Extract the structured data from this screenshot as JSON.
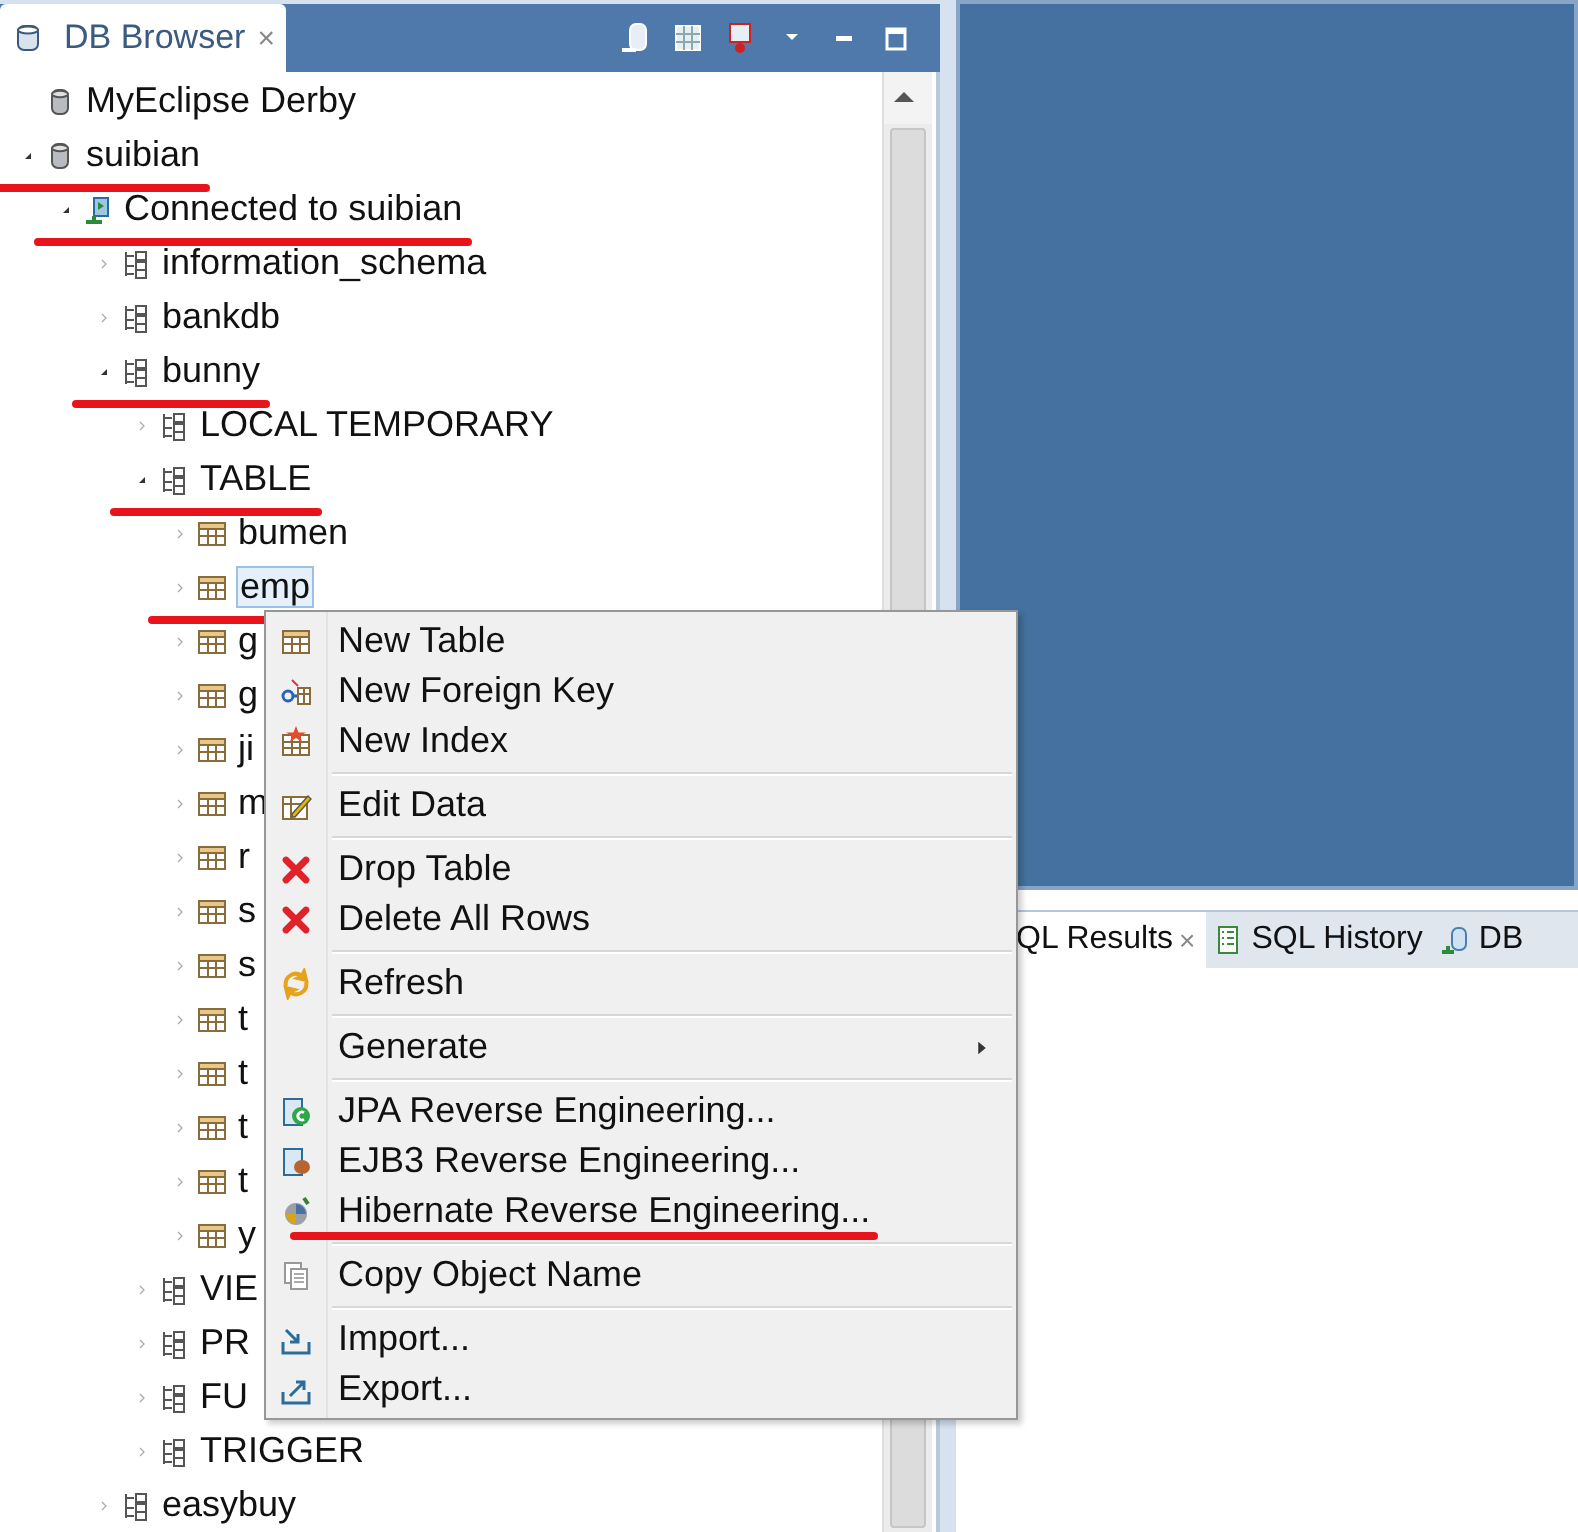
{
  "db_browser": {
    "tab": {
      "label": "DB Browser",
      "close": "×",
      "selected": true
    },
    "tree": [
      {
        "label": "MyEclipse Derby",
        "kind": "database",
        "selected": false,
        "marked": false
      },
      {
        "label": "suibian",
        "kind": "database",
        "expanded": true,
        "selected": false,
        "marked": true,
        "children": [
          {
            "label": "Connected to suibian",
            "kind": "connection",
            "expanded": true,
            "selected": false,
            "marked": true,
            "children": [
              {
                "label": "information_schema",
                "kind": "schema",
                "expanded": false,
                "selected": false,
                "marked": false
              },
              {
                "label": "bankdb",
                "kind": "schema",
                "expanded": false,
                "selected": false,
                "marked": false
              },
              {
                "label": "bunny",
                "kind": "schema",
                "expanded": true,
                "selected": false,
                "marked": true,
                "children": [
                  {
                    "label": "LOCAL TEMPORARY",
                    "kind": "schema",
                    "expanded": false,
                    "selected": false,
                    "marked": false
                  },
                  {
                    "label": "TABLE",
                    "kind": "schema",
                    "expanded": true,
                    "selected": false,
                    "marked": true,
                    "children": [
                      {
                        "label": "bumen",
                        "kind": "table",
                        "expanded": false,
                        "selected": false,
                        "marked": false
                      },
                      {
                        "label": "emp",
                        "kind": "table",
                        "expanded": false,
                        "selected": true,
                        "marked": true
                      },
                      {
                        "label": "g",
                        "kind": "table",
                        "expanded": false,
                        "selected": false,
                        "marked": false
                      },
                      {
                        "label": "g",
                        "kind": "table",
                        "expanded": false,
                        "selected": false,
                        "marked": false
                      },
                      {
                        "label": "ji",
                        "kind": "table",
                        "expanded": false,
                        "selected": false,
                        "marked": false
                      },
                      {
                        "label": "m",
                        "kind": "table",
                        "expanded": false,
                        "selected": false,
                        "marked": false
                      },
                      {
                        "label": "r",
                        "kind": "table",
                        "expanded": false,
                        "selected": false,
                        "marked": false
                      },
                      {
                        "label": "s",
                        "kind": "table",
                        "expanded": false,
                        "selected": false,
                        "marked": false
                      },
                      {
                        "label": "s",
                        "kind": "table",
                        "expanded": false,
                        "selected": false,
                        "marked": false
                      },
                      {
                        "label": "t",
                        "kind": "table",
                        "expanded": false,
                        "selected": false,
                        "marked": false
                      },
                      {
                        "label": "t",
                        "kind": "table",
                        "expanded": false,
                        "selected": false,
                        "marked": false
                      },
                      {
                        "label": "t",
                        "kind": "table",
                        "expanded": false,
                        "selected": false,
                        "marked": false
                      },
                      {
                        "label": "t",
                        "kind": "table",
                        "expanded": false,
                        "selected": false,
                        "marked": false
                      },
                      {
                        "label": "y",
                        "kind": "table",
                        "expanded": false,
                        "selected": false,
                        "marked": false
                      }
                    ]
                  },
                  {
                    "label": "VIE",
                    "kind": "schema",
                    "expanded": false,
                    "selected": false,
                    "marked": false
                  },
                  {
                    "label": "PR",
                    "kind": "schema",
                    "expanded": false,
                    "selected": false,
                    "marked": false
                  },
                  {
                    "label": "FU",
                    "kind": "schema",
                    "expanded": false,
                    "selected": false,
                    "marked": false
                  },
                  {
                    "label": "TRIGGER",
                    "kind": "schema",
                    "expanded": false,
                    "selected": false,
                    "marked": false
                  }
                ]
              },
              {
                "label": "easybuy",
                "kind": "schema",
                "expanded": false,
                "selected": false,
                "marked": false
              }
            ]
          }
        ]
      }
    ]
  },
  "context_menu": [
    [
      {
        "label": "New Table",
        "kind": "table"
      },
      {
        "label": "New Foreign Key",
        "kind": "key"
      },
      {
        "label": "New Index",
        "kind": "index"
      }
    ],
    [
      {
        "label": "Edit Data",
        "kind": "edit"
      }
    ],
    [
      {
        "label": "Drop Table",
        "kind": "delete"
      },
      {
        "label": "Delete All Rows",
        "kind": "delete"
      }
    ],
    [
      {
        "label": "Refresh",
        "kind": "refresh"
      }
    ],
    [
      {
        "label": "Generate",
        "kind": "submenu"
      }
    ],
    [
      {
        "label": "JPA Reverse Engineering...",
        "kind": "jpa"
      },
      {
        "label": "EJB3 Reverse Engineering...",
        "kind": "ejb"
      },
      {
        "label": "Hibernate Reverse Engineering...",
        "kind": "hibernate",
        "marked": true
      }
    ],
    [
      {
        "label": "Copy Object Name",
        "kind": "copy"
      }
    ],
    [
      {
        "label": "Import...",
        "kind": "import"
      },
      {
        "label": "Export...",
        "kind": "export"
      }
    ]
  ],
  "result_tabs": [
    {
      "label": "QL Results",
      "close": "×",
      "selected": true,
      "kind": "results"
    },
    {
      "label": "SQL History",
      "selected": false,
      "kind": "history"
    },
    {
      "label": "DB",
      "selected": false,
      "kind": "db"
    }
  ]
}
